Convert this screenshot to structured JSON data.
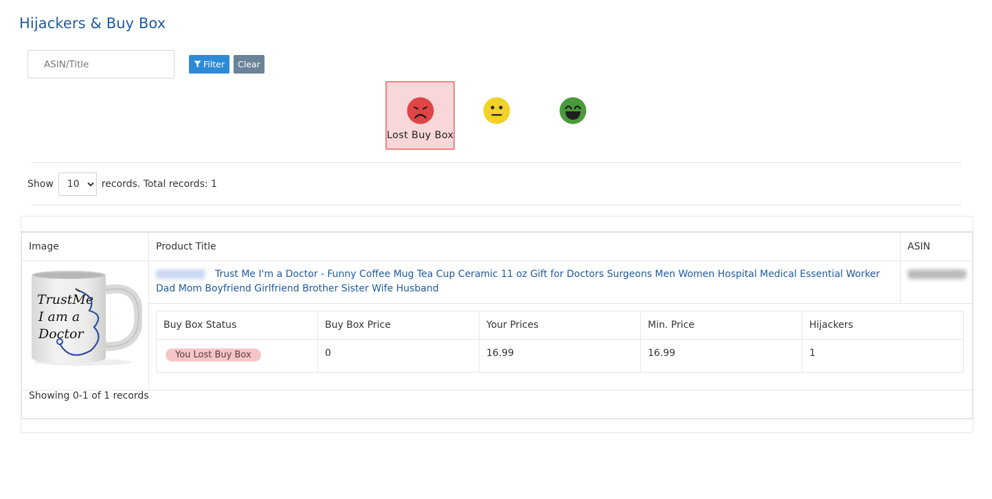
{
  "page": {
    "title": "Hijackers & Buy Box"
  },
  "search": {
    "placeholder": "ASIN/Title",
    "value": ""
  },
  "toolbar": {
    "filter_label": "Filter",
    "clear_label": "Clear"
  },
  "mood_filters": [
    {
      "icon": "angry-face-icon",
      "label": "Lost Buy Box",
      "active": true,
      "color": "#e04447"
    },
    {
      "icon": "neutral-face-icon",
      "label": "",
      "active": false,
      "color": "#f2d22a"
    },
    {
      "icon": "grinning-face-icon",
      "label": "",
      "active": false,
      "color": "#4a9a3a"
    }
  ],
  "pagination": {
    "show_label": "Show",
    "page_size": "10",
    "records_text": "records. Total records: 1",
    "showing_text": "Showing 0-1 of 1 records"
  },
  "table": {
    "headers": {
      "image": "Image",
      "title": "Product Title",
      "asin": "ASIN"
    },
    "rows": [
      {
        "image_alt": "Trust Me I am a Doctor mug",
        "mug_text": [
          "TrustMe",
          "I am a",
          "Doctor"
        ],
        "title": "Trust Me I'm a Doctor - Funny Coffee Mug Tea Cup Ceramic 11 oz Gift for Doctors Surgeons Men Women Hospital Medical Essential Worker Dad Mom Boyfriend Girlfriend Brother Sister Wife Husband",
        "sku_blurred": true,
        "asin_blurred": true,
        "details": {
          "headers": [
            "Buy Box Status",
            "Buy Box Price",
            "Your Prices",
            "Min. Price",
            "Hijackers"
          ],
          "status": "You Lost Buy Box",
          "buy_box_price": "0",
          "your_prices": "16.99",
          "min_price": "16.99",
          "hijackers": "1"
        }
      }
    ]
  },
  "colors": {
    "title": "#1e5aa0",
    "filter_button": "#2d8ad6",
    "clear_button": "#6b8299",
    "active_mood_bg": "#f8d7d8",
    "active_mood_border": "#ee8186",
    "badge_bg": "#f5c6c8"
  }
}
